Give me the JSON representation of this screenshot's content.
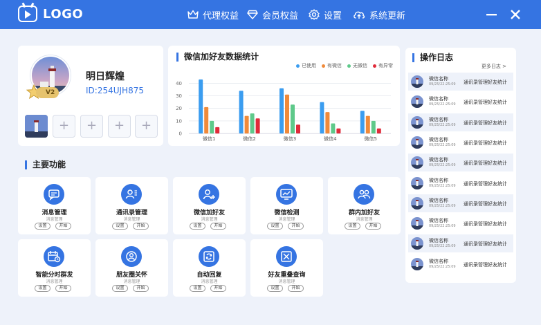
{
  "brand": {
    "logo_text": "LOGO"
  },
  "nav": [
    {
      "label": "代理权益",
      "icon": "crown-icon"
    },
    {
      "label": "会员权益",
      "icon": "diamond-icon"
    },
    {
      "label": "设置",
      "icon": "gear-icon"
    },
    {
      "label": "系统更新",
      "icon": "cloud-upload-icon"
    }
  ],
  "window": {
    "minimize": "minimize-icon",
    "close": "close-icon"
  },
  "profile": {
    "name": "明日辉煌",
    "id": "ID:254UJH875",
    "level": "V2",
    "slot_plus": "+"
  },
  "chart": {
    "title": "微信加好友数据统计"
  },
  "chart_data": {
    "type": "bar",
    "categories": [
      "微信1",
      "微信2",
      "微信3",
      "微信4",
      "微信5"
    ],
    "ylim": [
      0,
      40
    ],
    "yticks": [
      0,
      10,
      20,
      30,
      40
    ],
    "series": [
      {
        "name": "已使用",
        "color": "#3b9df0",
        "values": [
          43,
          34,
          36,
          25,
          18
        ]
      },
      {
        "name": "有微信",
        "color": "#f08a3a",
        "values": [
          21,
          14,
          31,
          17,
          14
        ]
      },
      {
        "name": "无微信",
        "color": "#5ec98a",
        "values": [
          10,
          16,
          23,
          8,
          10
        ]
      },
      {
        "name": "有异常",
        "color": "#e02b3a",
        "values": [
          5,
          12,
          7,
          4,
          4
        ]
      }
    ],
    "grid": true,
    "legend": "top-right"
  },
  "log": {
    "title": "操作日志",
    "more": "更多日志 >",
    "rows": [
      {
        "name": "微信名称",
        "time": "09/25/22:25:09",
        "action": "通讯录管理好友统计"
      },
      {
        "name": "微信名称",
        "time": "09/25/22:25:09",
        "action": "通讯录管理好友统计"
      },
      {
        "name": "微信名称",
        "time": "09/25/22:25:09",
        "action": "通讯录管理好友统计"
      },
      {
        "name": "微信名称",
        "time": "09/25/22:25:09",
        "action": "通讯录管理好友统计"
      },
      {
        "name": "微信名称",
        "time": "09/25/22:25:09",
        "action": "通讯录管理好友统计"
      },
      {
        "name": "微信名称",
        "time": "09/25/22:25:09",
        "action": "通讯录管理好友统计"
      },
      {
        "name": "微信名称",
        "time": "09/25/22:25:09",
        "action": "通讯录管理好友统计"
      },
      {
        "name": "微信名称",
        "time": "09/25/22:25:09",
        "action": "通讯录管理好友统计"
      },
      {
        "name": "微信名称",
        "time": "09/25/22:25:09",
        "action": "通讯录管理好友统计"
      },
      {
        "name": "微信名称",
        "time": "09/25/22:25:09",
        "action": "通讯录管理好友统计"
      }
    ]
  },
  "functions": {
    "title": "主要功能",
    "set_label": "设置",
    "start_label": "开始",
    "items": [
      {
        "name": "消息管理",
        "sub": "消息管理",
        "icon": "message-icon"
      },
      {
        "name": "通讯录管理",
        "sub": "消息管理",
        "icon": "contacts-icon"
      },
      {
        "name": "微信加好友",
        "sub": "消息管理",
        "icon": "add-friend-icon"
      },
      {
        "name": "微信检测",
        "sub": "消息管理",
        "icon": "monitor-chart-icon"
      },
      {
        "name": "群内加好友",
        "sub": "消息管理",
        "icon": "group-icon"
      },
      {
        "name": "智能分时群发",
        "sub": "消息管理",
        "icon": "calendar-clock-icon"
      },
      {
        "name": "朋友圈关怀",
        "sub": "消息管理",
        "icon": "moments-icon"
      },
      {
        "name": "自动回复",
        "sub": "消息管理",
        "icon": "auto-reply-icon"
      },
      {
        "name": "好友重叠查询",
        "sub": "消息管理",
        "icon": "overlap-search-icon"
      }
    ]
  }
}
